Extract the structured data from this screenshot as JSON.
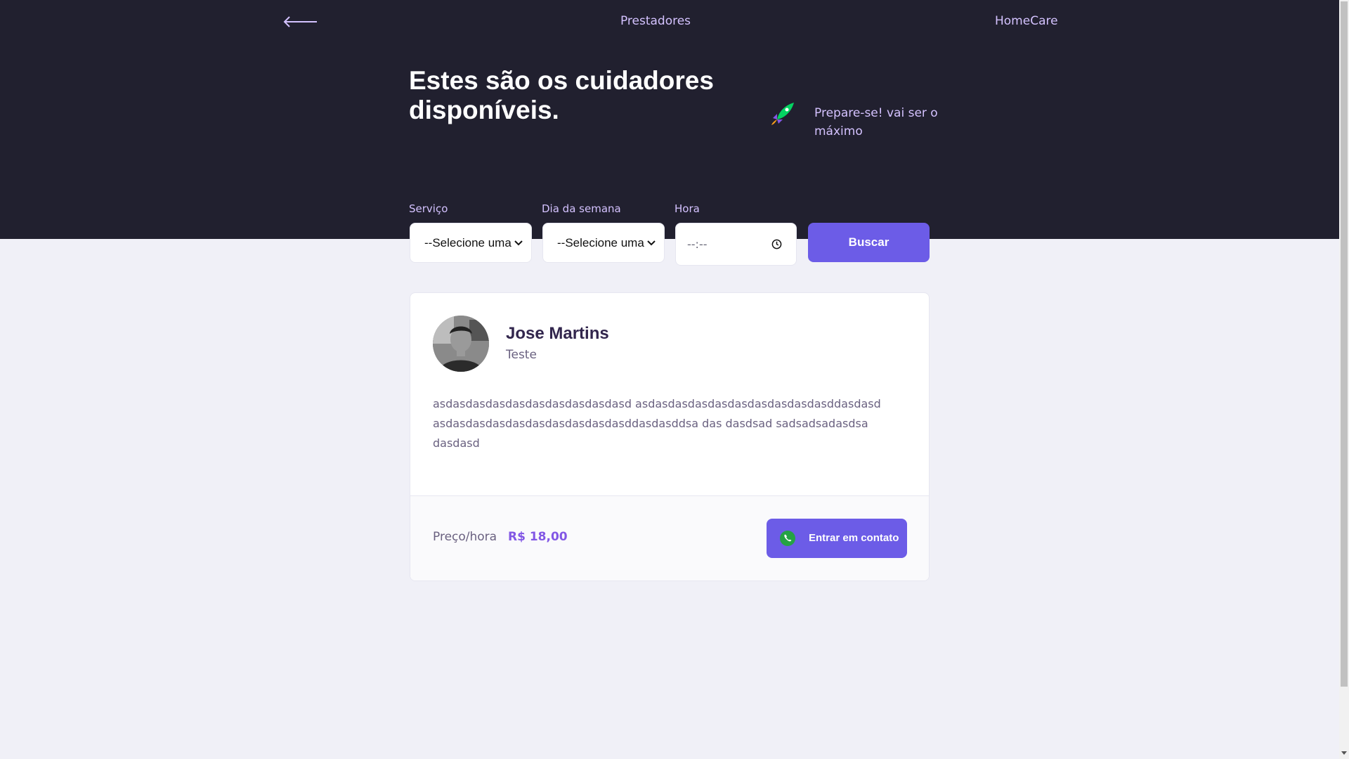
{
  "topbar": {
    "title": "Prestadores",
    "brand": "HomeCare"
  },
  "hero": {
    "title": "Estes são os cuidadores disponíveis.",
    "tagline": "Prepare-se! vai ser o máximo"
  },
  "search": {
    "service_label": "Serviço",
    "service_value": "--Selecione uma",
    "weekday_label": "Dia da semana",
    "weekday_value": "--Selecione uma",
    "time_label": "Hora",
    "time_value": "--:--",
    "submit_label": "Buscar"
  },
  "provider": {
    "name": "Jose Martins",
    "subject": "Teste",
    "bio": "asdasdasdasdasdasdasdasdasdasd asdasdasdasdasdasdasdasdasdasddasdasd asdasdasdasdasdasdasdasdasdasddasdasddsa das dasdsad sadsadsadasdsa dasdasd",
    "price_label": "Preço/hora",
    "price_value": "R$ 18,00",
    "contact_label": "Entrar em contato"
  },
  "colors": {
    "header_bg": "#21202f",
    "accent": "#6c5ce7",
    "price": "#8257e5",
    "muted_text": "#d4c2ff"
  },
  "icons": {
    "back": "arrow-left-icon",
    "rocket": "rocket-icon",
    "clock": "clock-icon",
    "contact": "whatsapp-icon"
  }
}
